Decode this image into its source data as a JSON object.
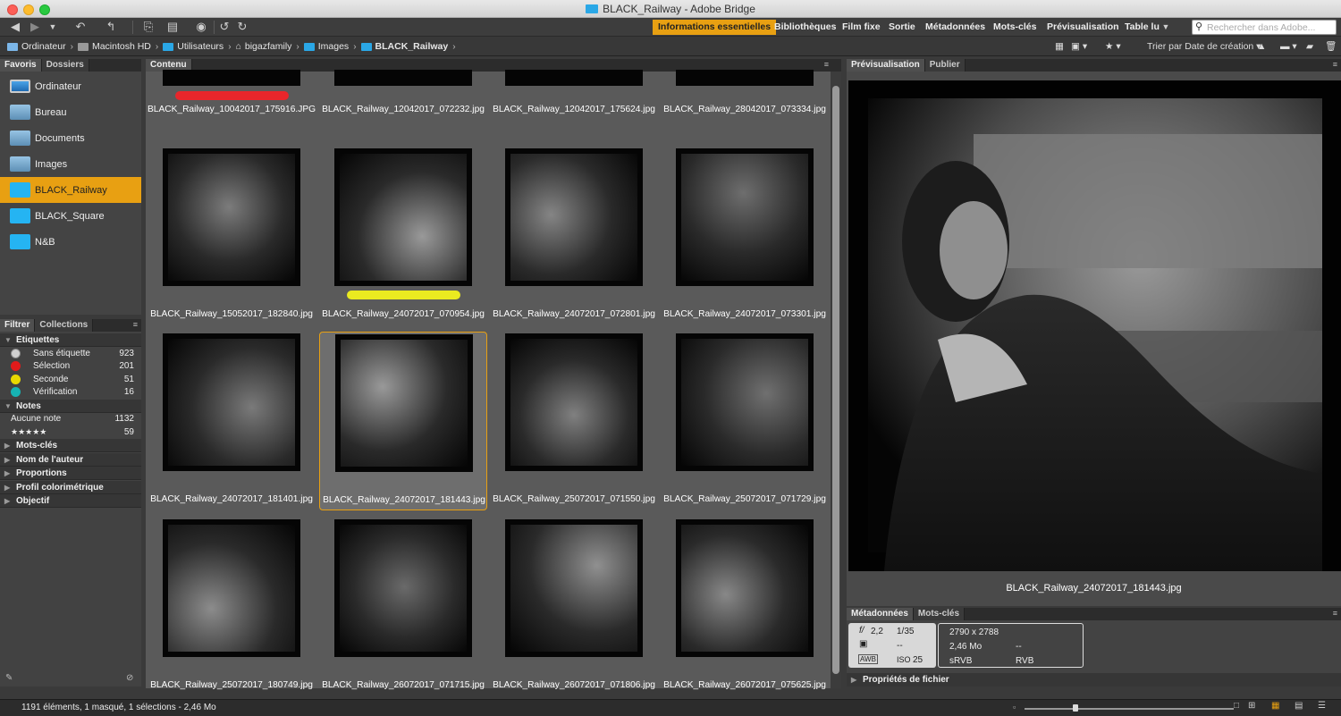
{
  "window": {
    "title": "BLACK_Railway - Adobe Bridge"
  },
  "workspaces": [
    {
      "label": "Informations essentielles",
      "active": true
    },
    {
      "label": "Bibliothèques"
    },
    {
      "label": "Film fixe"
    },
    {
      "label": "Sortie"
    },
    {
      "label": "Métadonnées"
    },
    {
      "label": "Mots-clés"
    },
    {
      "label": "Prévisualisation"
    },
    {
      "label": "Table lu"
    }
  ],
  "search": {
    "placeholder": "Rechercher dans Adobe..."
  },
  "breadcrumb": [
    "Ordinateur",
    "Macintosh HD",
    "Utilisateurs",
    "bigazfamily",
    "Images",
    "BLACK_Railway"
  ],
  "sort": {
    "label": "Trier par Date de création"
  },
  "favorites": {
    "tabs": [
      "Favoris",
      "Dossiers"
    ],
    "items": [
      {
        "label": "Ordinateur",
        "icon": "computer-icon"
      },
      {
        "label": "Bureau",
        "icon": "folder-icon"
      },
      {
        "label": "Documents",
        "icon": "folder-icon"
      },
      {
        "label": "Images",
        "icon": "folder-icon"
      },
      {
        "label": "BLACK_Railway",
        "icon": "folder-icon",
        "selected": true
      },
      {
        "label": "BLACK_Square",
        "icon": "folder-icon"
      },
      {
        "label": "N&B",
        "icon": "folder-icon"
      }
    ]
  },
  "filter": {
    "tabs": [
      "Filtrer",
      "Collections"
    ],
    "labels_header": "Etiquettes",
    "labels": [
      {
        "name": "Sans étiquette",
        "count": "923",
        "color": "#d0d0d0"
      },
      {
        "name": "Sélection",
        "count": "201",
        "color": "#e11b1b"
      },
      {
        "name": "Seconde",
        "count": "51",
        "color": "#e8d800"
      },
      {
        "name": "Vérification",
        "count": "16",
        "color": "#17b3b3"
      }
    ],
    "notes_header": "Notes",
    "notes": [
      {
        "name": "Aucune note",
        "count": "1132"
      },
      {
        "name": "★★★★★",
        "count": "59"
      }
    ],
    "sections": [
      "Mots-clés",
      "Nom de l'auteur",
      "Proportions",
      "Profil colorimétrique",
      "Objectif"
    ]
  },
  "content": {
    "tab": "Contenu",
    "files": [
      "BLACK_Railway_10042017_175916.JPG",
      "BLACK_Railway_12042017_072232.jpg",
      "BLACK_Railway_12042017_175624.jpg",
      "BLACK_Railway_28042017_073334.jpg",
      "BLACK_Railway_15052017_182840.jpg",
      "BLACK_Railway_24072017_070954.jpg",
      "BLACK_Railway_24072017_072801.jpg",
      "BLACK_Railway_24072017_073301.jpg",
      "BLACK_Railway_24072017_181401.jpg",
      "BLACK_Railway_24072017_181443.jpg",
      "BLACK_Railway_25072017_071550.jpg",
      "BLACK_Railway_25072017_071729.jpg",
      "BLACK_Railway_25072017_180749.jpg",
      "BLACK_Railway_26072017_071715.jpg",
      "BLACK_Railway_26072017_071806.jpg",
      "BLACK_Railway_26072017_075625.jpg"
    ]
  },
  "preview": {
    "tabs": [
      "Prévisualisation",
      "Publier"
    ],
    "filename": "BLACK_Railway_24072017_181443.jpg"
  },
  "metadata": {
    "tabs": [
      "Métadonnées",
      "Mots-clés"
    ],
    "aperture": "2,2",
    "shutter": "1/35",
    "exposure_comp": "--",
    "iso": "25",
    "dimensions": "2790 x 2788",
    "size": "2,46 Mo",
    "size2": "--",
    "colorspace": "sRVB",
    "mode": "RVB",
    "file_props": "Propriétés de fichier"
  },
  "status": {
    "text": "1191 éléments, 1 masqué, 1 sélections - 2,46 Mo"
  },
  "colors": {
    "accent": "#e8a012",
    "folder": "#25b4f2"
  }
}
